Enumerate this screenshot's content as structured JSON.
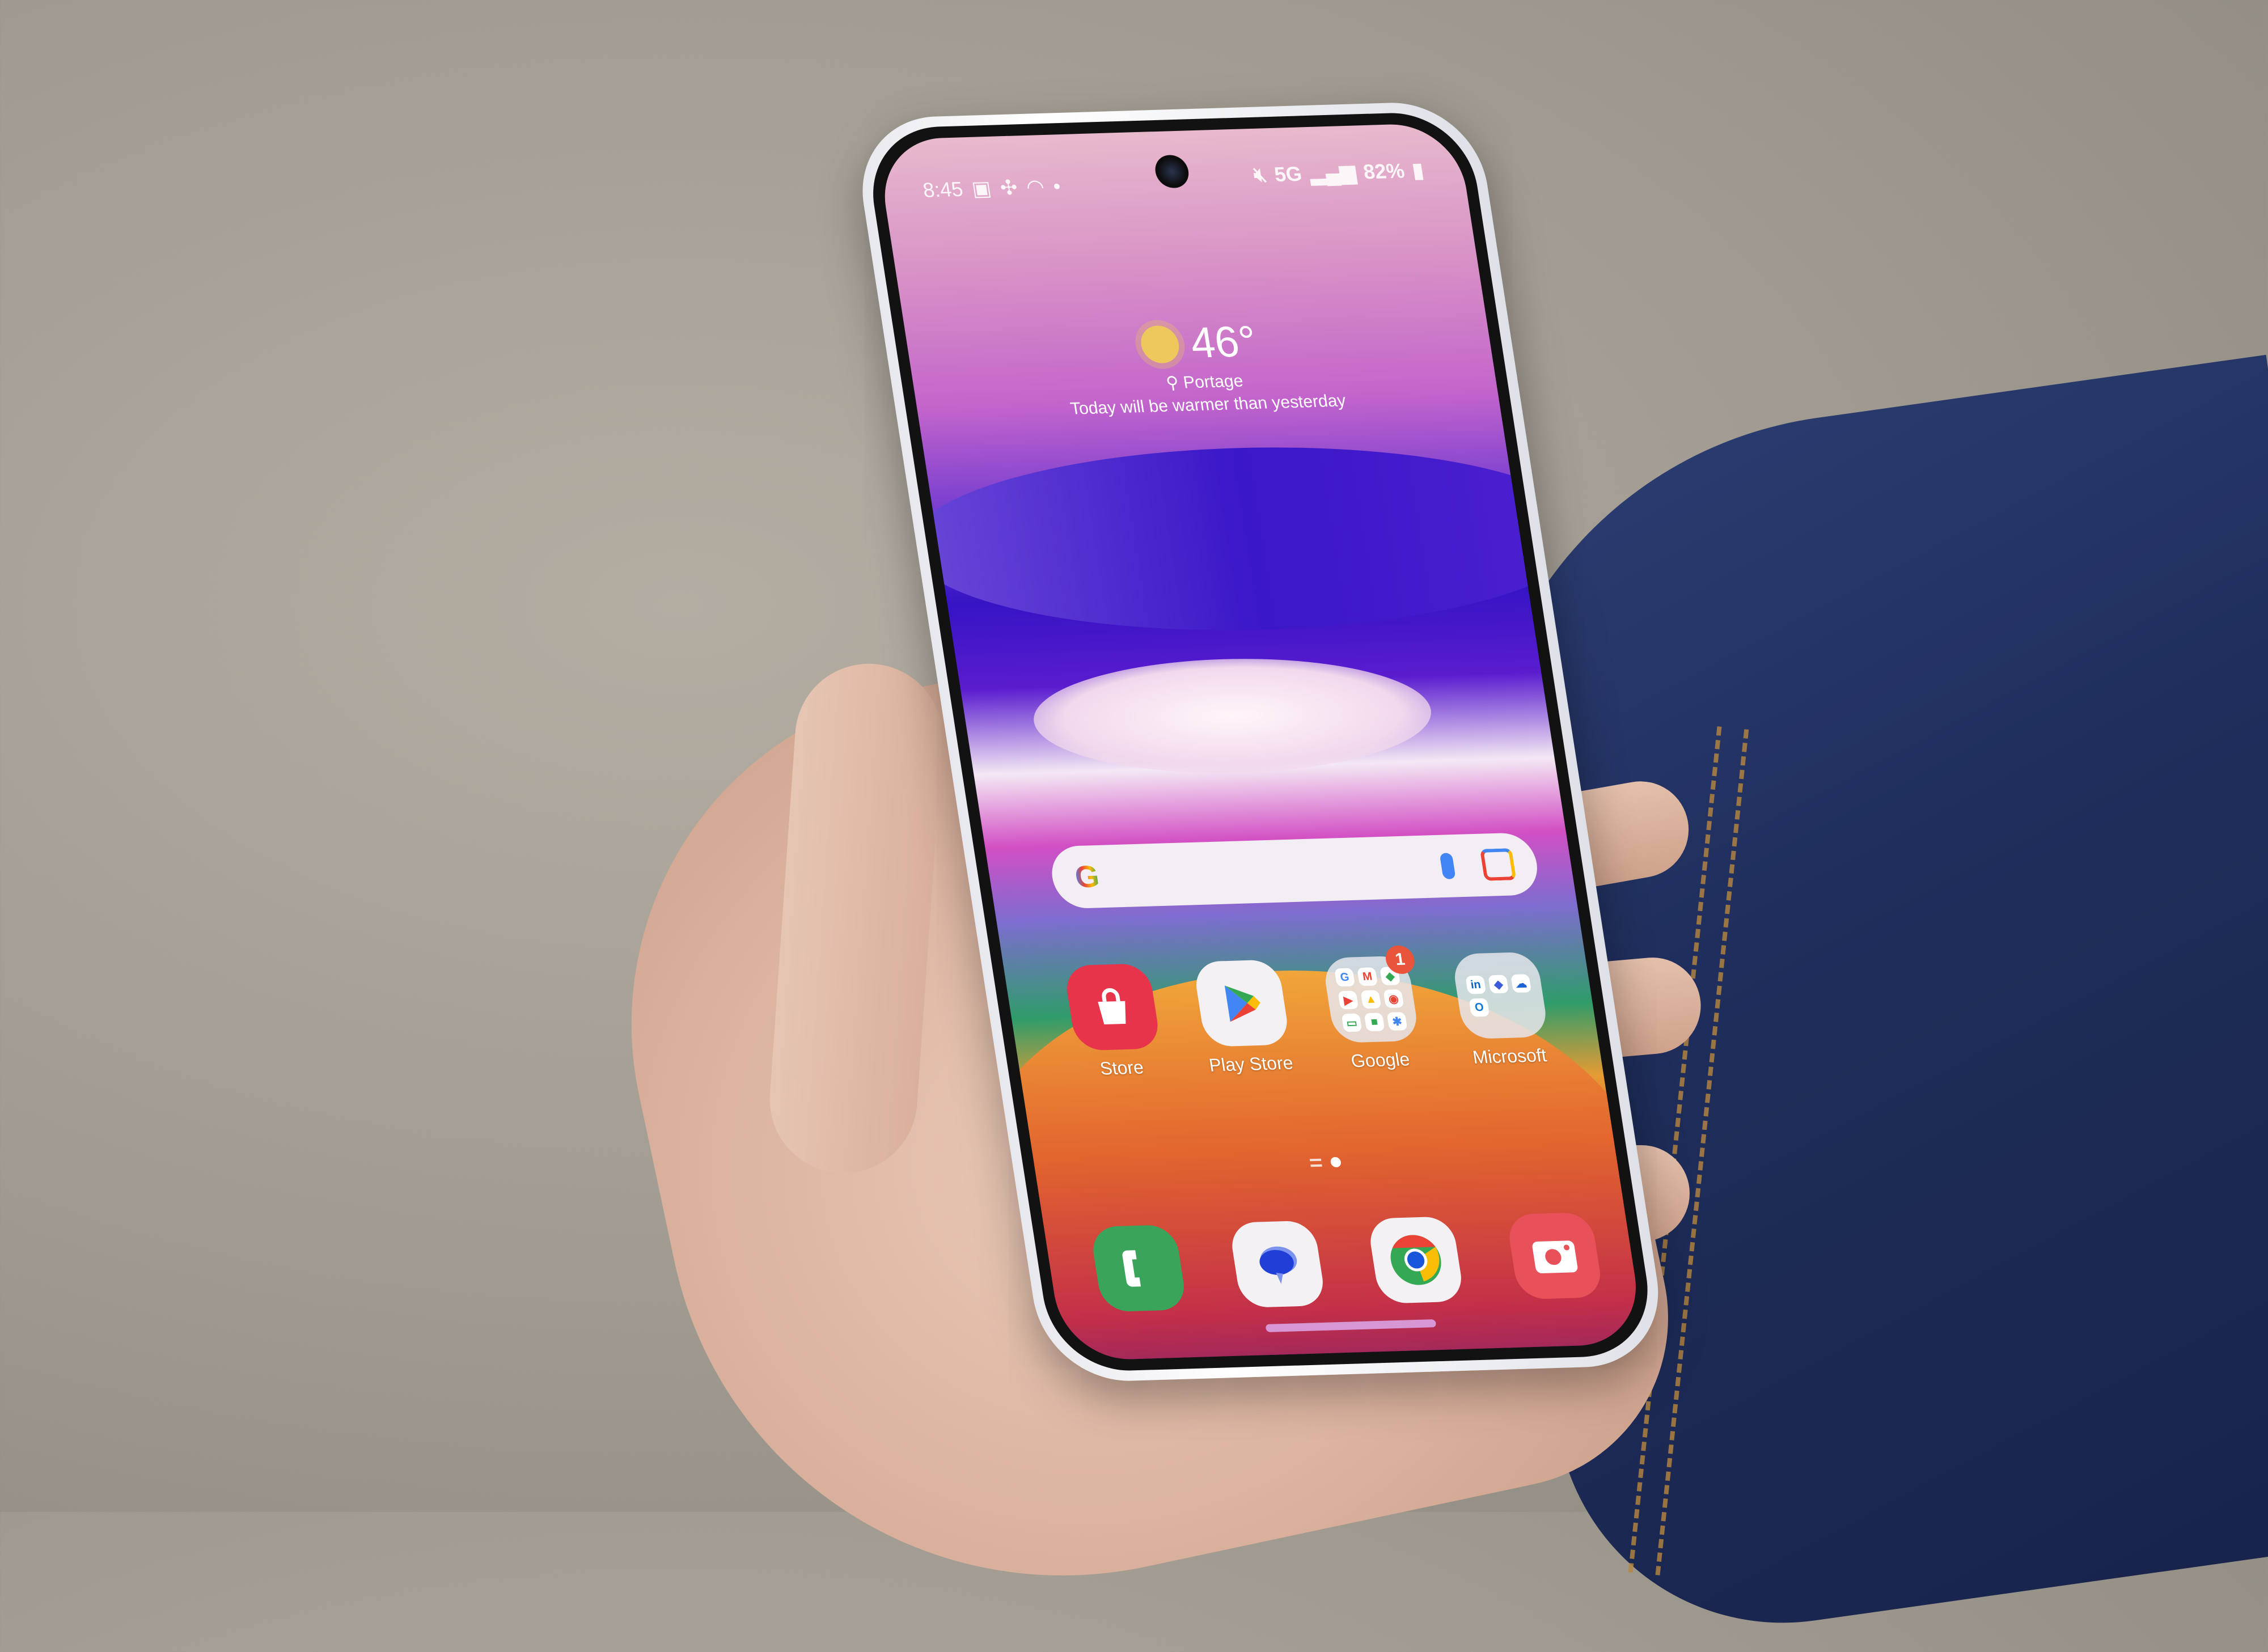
{
  "status_bar": {
    "time": "8:45",
    "left_icons": [
      "teams-icon",
      "pinwheel-icon",
      "wifi-icon",
      "dot-icon"
    ],
    "network": "5G",
    "battery": "82%"
  },
  "weather_widget": {
    "temperature": "46°",
    "location": "Portage",
    "message": "Today will be warmer than yesterday"
  },
  "search_bar": {
    "logo": "G",
    "placeholder": ""
  },
  "home_apps": [
    {
      "label": "Store",
      "icon": "shopping-bag-icon",
      "color": "#e8344a"
    },
    {
      "label": "Play Store",
      "icon": "play-store-icon",
      "color": "#f3f1f4"
    },
    {
      "label": "Google",
      "icon": "folder-icon",
      "badge": "1",
      "apps": [
        "G",
        "M",
        "◆",
        "▶",
        "▲",
        "◉",
        "▭",
        "■",
        "✱"
      ]
    },
    {
      "label": "Microsoft",
      "icon": "folder-icon",
      "apps": [
        "in",
        "◆",
        "☁",
        "O"
      ]
    }
  ],
  "dock": [
    {
      "icon": "phone-icon",
      "color": "#3aa55a"
    },
    {
      "icon": "messages-icon",
      "color": "#f3f1f4"
    },
    {
      "icon": "chrome-icon",
      "color": "#f3f1f4"
    },
    {
      "icon": "camera-icon",
      "color": "#e8505a"
    }
  ],
  "colors": {
    "badge": "#e8553a",
    "sun": "#ecc95a"
  }
}
